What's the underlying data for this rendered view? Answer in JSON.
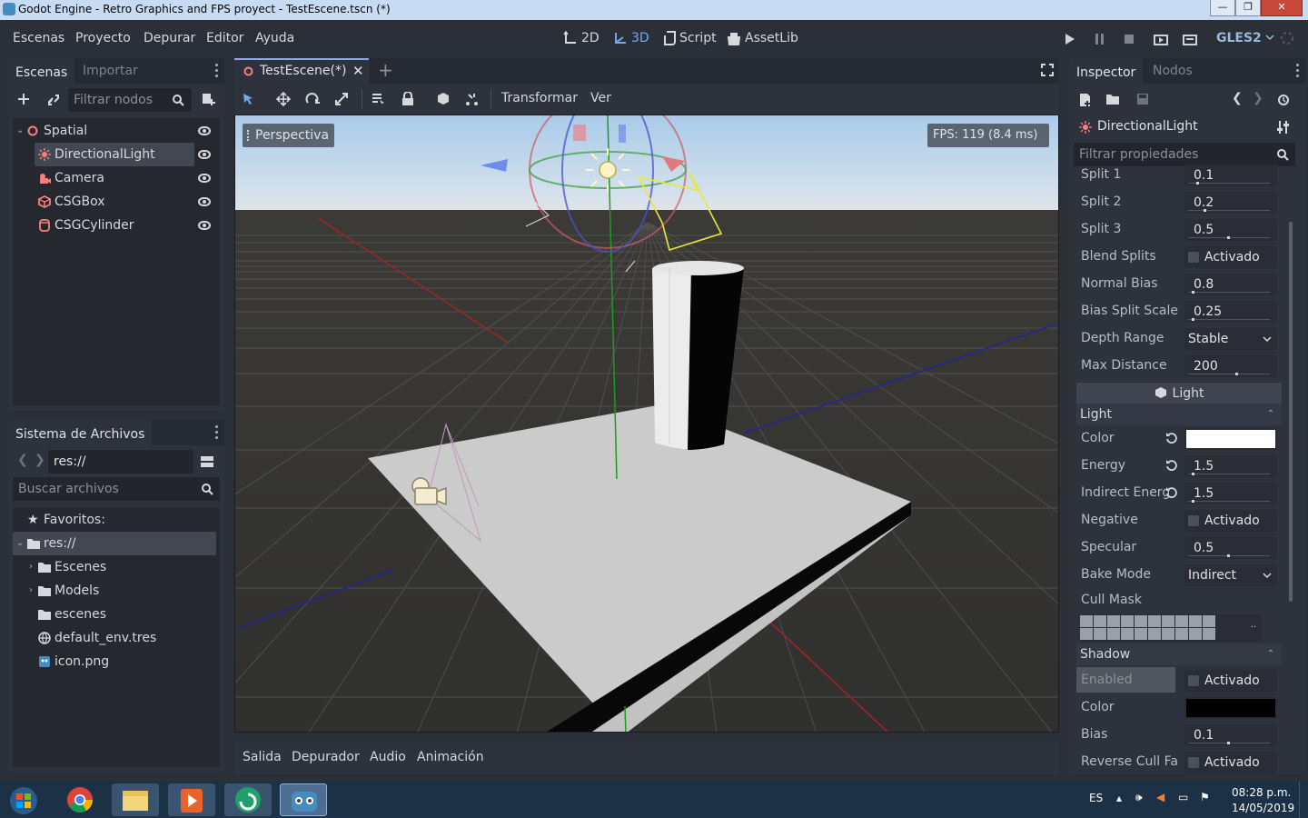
{
  "window": {
    "title": "Godot Engine - Retro Graphics and FPS proyect - TestEscene.tscn (*)"
  },
  "menu": {
    "items": [
      "Escenas",
      "Proyecto",
      "Depurar",
      "Editor",
      "Ayuda"
    ]
  },
  "modes": {
    "m2d": "2D",
    "m3d": "3D",
    "script": "Script",
    "assetlib": "AssetLib"
  },
  "renderer": "GLES2",
  "scene_dock": {
    "tabs": [
      "Escenas",
      "Importar"
    ],
    "filter_placeholder": "Filtrar nodos",
    "nodes": [
      {
        "label": "Spatial",
        "icon": "spatial-icon"
      },
      {
        "label": "DirectionalLight",
        "icon": "directional-light-icon"
      },
      {
        "label": "Camera",
        "icon": "camera-icon"
      },
      {
        "label": "CSGBox",
        "icon": "csg-box-icon"
      },
      {
        "label": "CSGCylinder",
        "icon": "csg-cylinder-icon"
      }
    ]
  },
  "filesystem": {
    "tab": "Sistema de Archivos",
    "path": "res://",
    "search_placeholder": "Buscar archivos",
    "items": [
      {
        "label": "Favoritos:",
        "icon": "star-icon"
      },
      {
        "label": "res://",
        "icon": "folder-icon"
      },
      {
        "label": "Escenes",
        "icon": "folder-icon"
      },
      {
        "label": "Models",
        "icon": "folder-icon"
      },
      {
        "label": "escenes",
        "icon": "folder-icon"
      },
      {
        "label": "default_env.tres",
        "icon": "globe-icon"
      },
      {
        "label": "icon.png",
        "icon": "image-icon"
      }
    ]
  },
  "editor": {
    "tab": "TestEscene(*)",
    "toolbar_menus": [
      "Transformar",
      "Ver"
    ],
    "perspective_label": "Perspectiva",
    "fps": "FPS: 119 (8.4 ms)"
  },
  "bottom_tabs": [
    "Salida",
    "Depurador",
    "Audio",
    "Animación"
  ],
  "inspector": {
    "tabs": [
      "Inspector",
      "Nodos"
    ],
    "node_name": "DirectionalLight",
    "filter_placeholder": "Filtrar propiedades",
    "props_top": [
      {
        "label": "Split 1",
        "value": "0.1",
        "type": "slider",
        "level": 0.1
      },
      {
        "label": "Split 2",
        "value": "0.2",
        "type": "slider",
        "level": 0.2
      },
      {
        "label": "Split 3",
        "value": "0.5",
        "type": "slider",
        "level": 0.5
      },
      {
        "label": "Blend Splits",
        "value": "Activado",
        "type": "check"
      },
      {
        "label": "Normal Bias",
        "value": "0.8",
        "type": "slider",
        "level": 0.05
      },
      {
        "label": "Bias Split Scale",
        "value": "0.25",
        "type": "slider",
        "level": 0.05
      },
      {
        "label": "Depth Range",
        "value": "Stable",
        "type": "enum"
      },
      {
        "label": "Max Distance",
        "value": "200",
        "type": "slider",
        "level": 0.6
      }
    ],
    "light_category": "Light",
    "light_section": "Light",
    "props_light": [
      {
        "label": "Color",
        "type": "color",
        "color": "#ffffff",
        "reset": true
      },
      {
        "label": "Energy",
        "value": "1.5",
        "type": "slider",
        "level": 0.05,
        "reset": true
      },
      {
        "label": "Indirect Energ",
        "value": "1.5",
        "type": "slider",
        "level": 0.05,
        "reset": true
      },
      {
        "label": "Negative",
        "value": "Activado",
        "type": "check"
      },
      {
        "label": "Specular",
        "value": "0.5",
        "type": "slider",
        "level": 0.5
      },
      {
        "label": "Bake Mode",
        "value": "Indirect",
        "type": "enum"
      }
    ],
    "cull_mask_label": "Cull Mask",
    "shadow_section": "Shadow",
    "props_shadow": [
      {
        "label": "Enabled",
        "value": "Activado",
        "type": "check"
      },
      {
        "label": "Color",
        "type": "color",
        "color": "#000000"
      },
      {
        "label": "Bias",
        "value": "0.1",
        "type": "slider",
        "level": 0.5
      },
      {
        "label": "Reverse Cull Fa",
        "value": "Activado",
        "type": "check"
      }
    ]
  },
  "taskbar": {
    "lang": "ES",
    "time": "08:28 p.m.",
    "date": "14/05/2019"
  }
}
